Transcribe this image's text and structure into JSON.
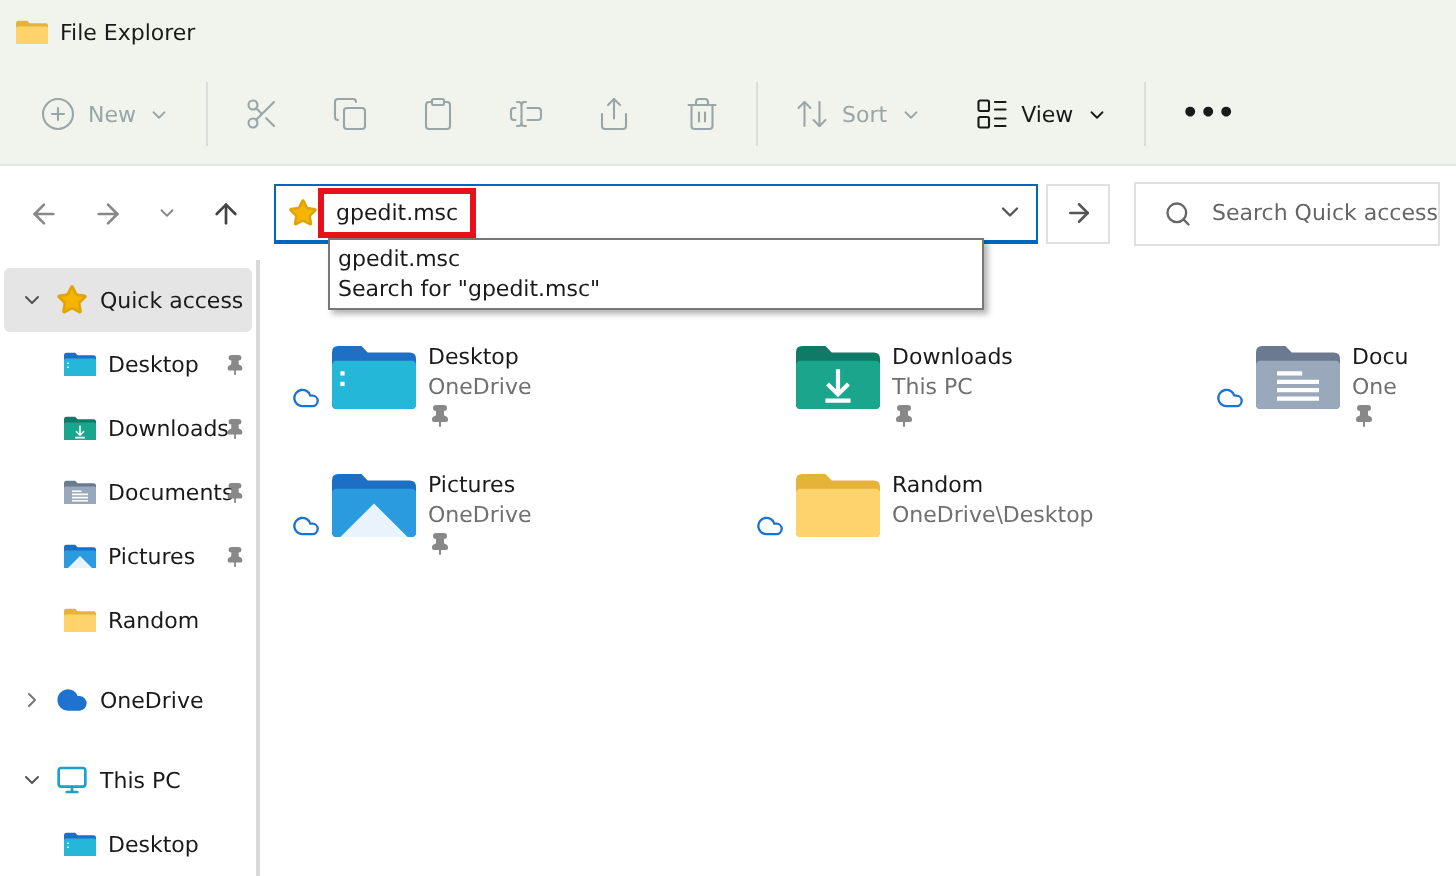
{
  "window": {
    "title": "File Explorer"
  },
  "toolbar": [
    {
      "kind": "new",
      "label": "New",
      "disabled": true
    },
    {
      "kind": "cut",
      "disabled": true
    },
    {
      "kind": "copy",
      "disabled": true
    },
    {
      "kind": "paste",
      "disabled": true
    },
    {
      "kind": "rename",
      "disabled": true
    },
    {
      "kind": "share",
      "disabled": true
    },
    {
      "kind": "delete",
      "disabled": true
    },
    {
      "kind": "sort",
      "label": "Sort",
      "disabled": true
    },
    {
      "kind": "view",
      "label": "View",
      "disabled": false
    },
    {
      "kind": "more",
      "label": "•••",
      "disabled": false
    }
  ],
  "address": {
    "value": "gpedit.msc",
    "highlighted": true,
    "suggestions": [
      "gpedit.msc",
      "Search for \"gpedit.msc\""
    ]
  },
  "search": {
    "placeholder": "Search Quick access"
  },
  "sidebar": {
    "items": [
      {
        "kind": "star",
        "label": "Quick access",
        "selected": true,
        "expanded": true,
        "children": [
          {
            "kind": "desktop",
            "label": "Desktop",
            "pinned": true
          },
          {
            "kind": "downloads",
            "label": "Downloads",
            "pinned": true
          },
          {
            "kind": "documents",
            "label": "Documents",
            "pinned": true
          },
          {
            "kind": "pictures",
            "label": "Pictures",
            "pinned": true
          },
          {
            "kind": "folder",
            "label": "Random",
            "pinned": false
          }
        ]
      },
      {
        "kind": "cloud",
        "label": "OneDrive",
        "selected": false,
        "expanded": false
      },
      {
        "kind": "pc",
        "label": "This PC",
        "selected": false,
        "expanded": true,
        "children": [
          {
            "kind": "desktop",
            "label": "Desktop",
            "pinned": false
          }
        ]
      }
    ]
  },
  "folders": [
    {
      "kind": "desktop",
      "name": "Desktop",
      "location": "OneDrive",
      "synced": true,
      "pinned": true
    },
    {
      "kind": "downloads",
      "name": "Downloads",
      "location": "This PC",
      "synced": false,
      "pinned": true
    },
    {
      "kind": "documents",
      "name": "Docu",
      "location": "One",
      "synced": true,
      "pinned": true
    },
    {
      "kind": "pictures",
      "name": "Pictures",
      "location": "OneDrive",
      "synced": true,
      "pinned": true
    },
    {
      "kind": "folder",
      "name": "Random",
      "location": "OneDrive\\Desktop",
      "synced": true,
      "pinned": false
    }
  ]
}
